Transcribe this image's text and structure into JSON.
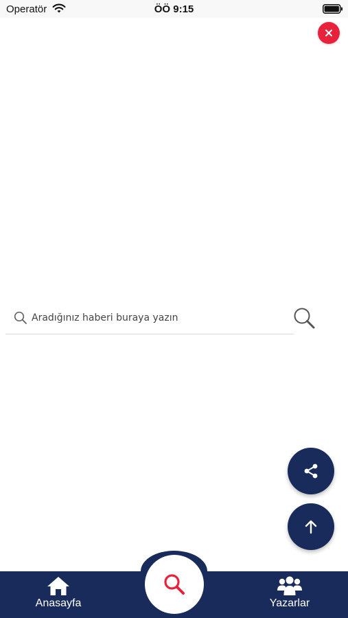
{
  "status_bar": {
    "carrier": "Operatör",
    "time": "ÖÖ 9:15"
  },
  "search": {
    "placeholder": "Aradığınız haberi buraya yazın",
    "value": ""
  },
  "bottom_nav": {
    "items": [
      {
        "label": "Anasayfa",
        "icon": "home-icon"
      },
      {
        "label": "Yazarlar",
        "icon": "users-icon"
      }
    ],
    "center_icon": "search-icon"
  },
  "colors": {
    "navy": "#182b5b",
    "red": "#e8223b",
    "accent_search": "#e8223b"
  }
}
